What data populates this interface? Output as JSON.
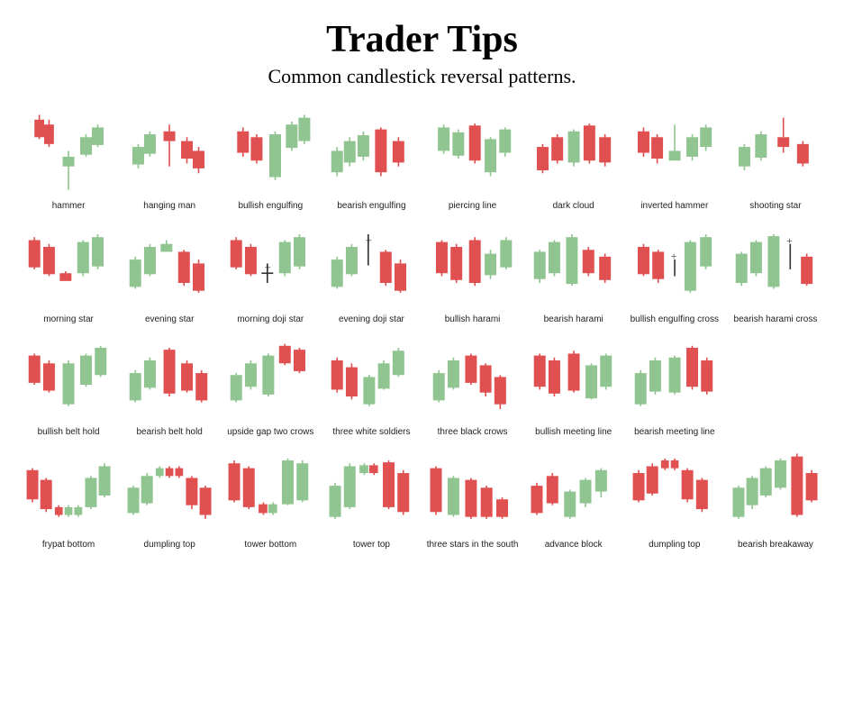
{
  "title": "Trader Tips",
  "subtitle": "Common candlestick reversal patterns.",
  "patterns": [
    {
      "id": "hammer",
      "label": "hammer"
    },
    {
      "id": "hanging-man",
      "label": "hanging man"
    },
    {
      "id": "bullish-engulfing",
      "label": "bullish engulfing"
    },
    {
      "id": "bearish-engulfing",
      "label": "bearish engulfing"
    },
    {
      "id": "piercing-line",
      "label": "piercing line"
    },
    {
      "id": "dark-cloud",
      "label": "dark cloud"
    },
    {
      "id": "inverted-hammer",
      "label": "inverted hammer"
    },
    {
      "id": "shooting-star",
      "label": "shooting star"
    },
    {
      "id": "morning-star",
      "label": "morning star"
    },
    {
      "id": "evening-star",
      "label": "evening star"
    },
    {
      "id": "morning-doji-star",
      "label": "morning doji star"
    },
    {
      "id": "evening-doji-star",
      "label": "evening doji star"
    },
    {
      "id": "bullish-harami",
      "label": "bullish harami"
    },
    {
      "id": "bearish-harami",
      "label": "bearish harami"
    },
    {
      "id": "bullish-engulfing-cross",
      "label": "bullish engulfing cross"
    },
    {
      "id": "bearish-harami-cross",
      "label": "bearish harami cross"
    },
    {
      "id": "bullish-belt-hold",
      "label": "bullish belt hold"
    },
    {
      "id": "bearish-belt-hold",
      "label": "bearish belt hold"
    },
    {
      "id": "upside-gap-two-crows",
      "label": "upside gap two crows"
    },
    {
      "id": "three-white-soldiers",
      "label": "three white soldiers"
    },
    {
      "id": "three-black-crows",
      "label": "three black crows"
    },
    {
      "id": "bullish-meeting-line",
      "label": "bullish meeting line"
    },
    {
      "id": "bearish-meeting-line",
      "label": "bearish meeting line"
    },
    {
      "id": "frypat-bottom",
      "label": "frypat bottom"
    },
    {
      "id": "dumpling-top-1",
      "label": "dumpling top"
    },
    {
      "id": "tower-bottom",
      "label": "tower bottom"
    },
    {
      "id": "tower-top",
      "label": "tower top"
    },
    {
      "id": "three-stars-south",
      "label": "three stars in the south"
    },
    {
      "id": "advance-block",
      "label": "advance block"
    },
    {
      "id": "dumpling-top-2",
      "label": "dumpling top"
    },
    {
      "id": "bearish-breakaway",
      "label": "bearish breakaway"
    }
  ]
}
